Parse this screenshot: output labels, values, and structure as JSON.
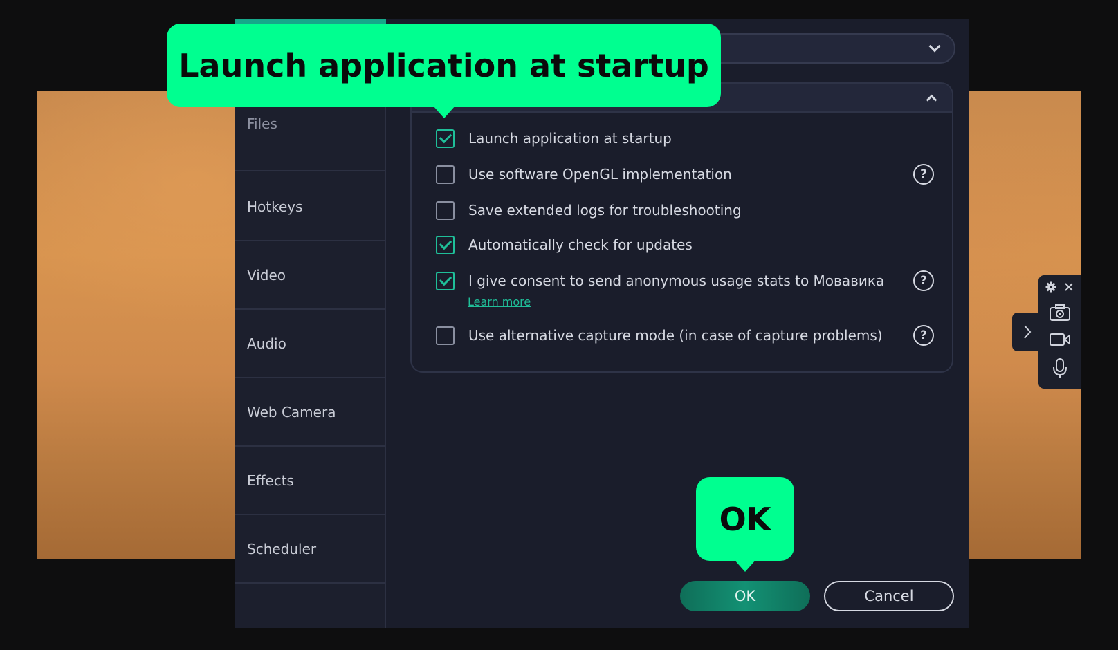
{
  "sidebar": {
    "items": [
      {
        "label": "Files"
      },
      {
        "label": "Hotkeys"
      },
      {
        "label": "Video"
      },
      {
        "label": "Audio"
      },
      {
        "label": "Web Camera"
      },
      {
        "label": "Effects"
      },
      {
        "label": "Scheduler"
      }
    ]
  },
  "options": [
    {
      "label": "Launch application at startup",
      "checked": true,
      "help": false
    },
    {
      "label": "Use software OpenGL implementation",
      "checked": false,
      "help": true
    },
    {
      "label": "Save extended logs for troubleshooting",
      "checked": false,
      "help": false
    },
    {
      "label": "Automatically check for updates",
      "checked": true,
      "help": false
    },
    {
      "label": "I give consent to send anonymous usage stats to Мовавика",
      "checked": true,
      "help": true
    },
    {
      "label": "Use alternative capture mode (in case of capture problems)",
      "checked": false,
      "help": true
    }
  ],
  "learn_more": "Learn more",
  "buttons": {
    "ok": "OK",
    "cancel": "Cancel"
  },
  "callouts": {
    "top": "Launch application at startup",
    "ok": "OK"
  },
  "toolbar": {
    "icons": [
      "gear-icon",
      "close-icon",
      "camera-icon",
      "video-icon",
      "microphone-icon",
      "chevron-right-icon"
    ]
  },
  "colors": {
    "accent": "#1fbf99",
    "callout": "#00ff90",
    "dialog_bg": "#1a1d2b"
  }
}
